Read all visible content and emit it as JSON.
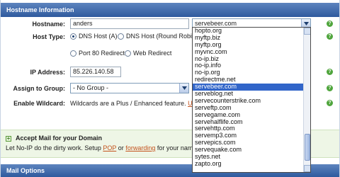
{
  "hostname_section": {
    "title": "Hostname Information"
  },
  "form": {
    "hostname_label": "Hostname:",
    "hostname_value": "anders",
    "domain_selected": "servebeer.com",
    "host_type_label": "Host Type:",
    "host_type_options": [
      "DNS Host (A)",
      "DNS Host (Round Robin)",
      "Port 80 Redirect",
      "Web Redirect"
    ],
    "ip_label": "IP Address:",
    "ip_value": "85.226.140.58",
    "group_label": "Assign to Group:",
    "group_value": "- No Group -",
    "wildcard_label": "Enable Wildcard:",
    "wildcard_text": "Wildcards are a Plus / Enhanced feature.",
    "wildcard_link": "Upgr"
  },
  "domain_dropdown": {
    "items": [
      "hopto.org",
      "myftp.biz",
      "myftp.org",
      "myvnc.com",
      "no-ip.biz",
      "no-ip.info",
      "no-ip.org",
      "redirectme.net",
      "servebeer.com",
      "serveblog.net",
      "servecounterstrike.com",
      "serveftp.com",
      "servegame.com",
      "servehalflife.com",
      "servehttp.com",
      "servemp3.com",
      "servepics.com",
      "servequake.com",
      "sytes.net",
      "zapto.org"
    ],
    "selected_index": 8
  },
  "mail_section": {
    "title": "Accept Mail for your Domain",
    "text_before": "Let No-IP do the dirty work. Setup",
    "link1": "POP",
    "text_mid": "or",
    "link2": "forwarding",
    "text_after": "for your name."
  },
  "mail_options": {
    "title": "Mail Options"
  },
  "colors": {
    "header": "#2f5a9e",
    "selected": "#3165c9",
    "help": "#4fa53c",
    "link": "#c4521d"
  }
}
